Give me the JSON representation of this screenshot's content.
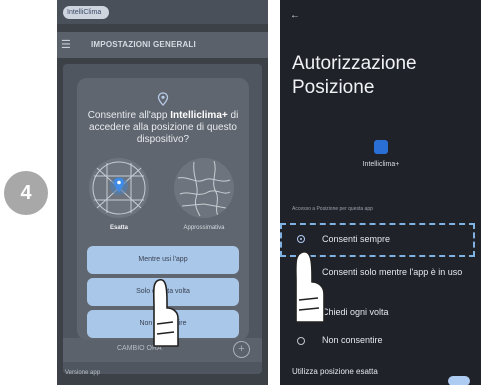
{
  "step": {
    "number": "4"
  },
  "left_screen": {
    "app_logo": "IntelliClima",
    "header_title": "IMPOSTAZIONI GENERALI",
    "dialog": {
      "message_prefix": "Consentire all'app ",
      "app_name": "Intelliclima+",
      "message_suffix": " di accedere alla posizione di questo dispositivo?",
      "option_exact": "Esatta",
      "option_approx": "Approssimativa",
      "buttons": [
        "Mentre usi l'app",
        "Solo questa volta",
        "Non consentire"
      ]
    },
    "bottom_label": "CAMBIO ORA",
    "footer_label": "Versione app"
  },
  "right_screen": {
    "title_line1": "Autorizzazione",
    "title_line2": "Posizione",
    "app_name": "Intelliclima+",
    "section_label": "Accesso a Posizione per questa app",
    "options": [
      {
        "label": "Consenti sempre",
        "selected": true
      },
      {
        "label": "Consenti solo mentre l'app è in uso",
        "selected": false
      },
      {
        "label": "Chiedi ogni volta",
        "selected": false
      },
      {
        "label": "Non consentire",
        "selected": false
      }
    ],
    "exact_location_label": "Utilizza posizione esatta"
  },
  "colors": {
    "accent": "#aecbf2",
    "highlight": "#7fb1e3",
    "dialog_button": "#a9c7e9"
  }
}
